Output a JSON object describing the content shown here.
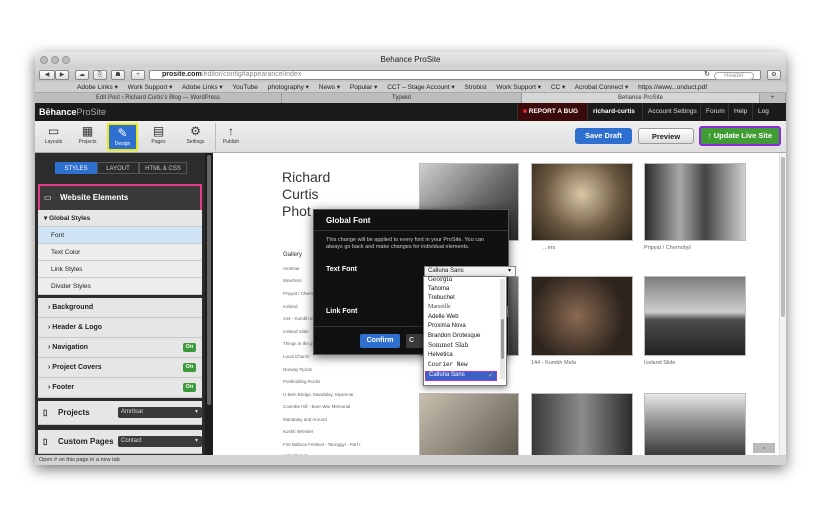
{
  "browser": {
    "title": "Behance ProSite",
    "url_domain": "prosite.com",
    "url_path": "/editor/config#appearance/index",
    "reader": "Reader",
    "bookmarks": [
      "Adobe Links ▾",
      "Work Support ▾",
      "Adobe Links ▾",
      "YouTube",
      "photography ▾",
      "News ▾",
      "Popular ▾",
      "CCT – Stage Account ▾",
      "Strobist",
      "Work Support ▾",
      "CC ▾",
      "Acrobat Connect ▾",
      "https://www...onduct.pdf"
    ],
    "tabs": [
      "Edit Post ‹ Richard Curtis's Blog — WordPress",
      "Typekit",
      "Behance ProSite"
    ],
    "status": "Open # on this page in a new tab"
  },
  "behance": {
    "logo_brand": "Bēhance",
    "logo_product": "ProSite",
    "report_bug": "REPORT A BUG",
    "user": "richard-curtis",
    "account_settings": "Account Settings",
    "forum": "Forum",
    "help": "Help",
    "logout": "Log Out"
  },
  "toolbar": {
    "buttons": [
      {
        "label": "Layouts",
        "icon": "▭"
      },
      {
        "label": "Projects",
        "icon": "▦"
      },
      {
        "label": "Design",
        "icon": "✎"
      },
      {
        "label": "Pages",
        "icon": "▤"
      },
      {
        "label": "Settings",
        "icon": "⚙"
      },
      {
        "label": "Publish",
        "icon": "↑"
      }
    ],
    "save_draft": "Save Draft",
    "preview": "Preview",
    "update_live": "Update Live Site"
  },
  "sidebar": {
    "tabs": [
      "STYLES",
      "LAYOUT",
      "HTML & CSS"
    ],
    "website_elements": "Website Elements",
    "global_styles": "Global Styles",
    "items": [
      "Font",
      "Text Color",
      "Link Styles",
      "Divider Styles"
    ],
    "sections": [
      {
        "label": "Background",
        "badge": ""
      },
      {
        "label": "Header & Logo",
        "badge": ""
      },
      {
        "label": "Navigation",
        "badge": "On"
      },
      {
        "label": "Project Covers",
        "badge": "On"
      },
      {
        "label": "Footer",
        "badge": "On"
      }
    ],
    "projects_label": "Projects",
    "projects_value": "Amritsar",
    "custom_pages_label": "Custom Pages",
    "custom_pages_value": "Contact"
  },
  "site": {
    "name_lines": [
      "Richard",
      "Curtis",
      "Phot"
    ],
    "gallery_heading": "Gallery",
    "gallery_links": [
      "Amritsar",
      "Weezlers",
      "Pripyat / Chernobyl",
      "Iceland",
      "144 - Kumbh Mela",
      "Iceland Slide",
      "Things in the p...",
      "Local Church",
      "Norway Fjords",
      "Postholding Rocks",
      "U Bein Bridge, Mandalay, Myanmar",
      "Coombe Hill - Boer War Memorial",
      "Mandalay and Around",
      "Kushti Wrestler",
      "Fire Balloon Festival - Taunggyi - Part I",
      "Lake Danum"
    ],
    "captions": [
      "...ers",
      "Pripyat / Chernobyl",
      "144 - Kumbh Mela",
      "Iceland Slide"
    ]
  },
  "dialog": {
    "title": "Global Font",
    "message": "This change will be applied to every font in your ProSite. You can always go back and make changes for individual elements.",
    "text_font_label": "Text Font",
    "text_font_value": "Calluna Sans",
    "link_font_label": "Link Font",
    "confirm": "Confirm",
    "cancel": "C"
  },
  "font_list": {
    "items": [
      "Georgia",
      "Tahoma",
      "Trebuchet",
      "Marseille",
      "Adelle Web",
      "Proxima Nova",
      "Brandon Grotesque",
      "Sommet Slab",
      "Helvetica",
      "Courier New",
      "Calluna Sans"
    ],
    "selected": "Calluna Sans"
  },
  "colors": {
    "accent_blue": "#2e6fd0",
    "update_green": "#3f9d33",
    "highlight_pink": "#e23a8c",
    "highlight_purple": "#8a2be2"
  }
}
